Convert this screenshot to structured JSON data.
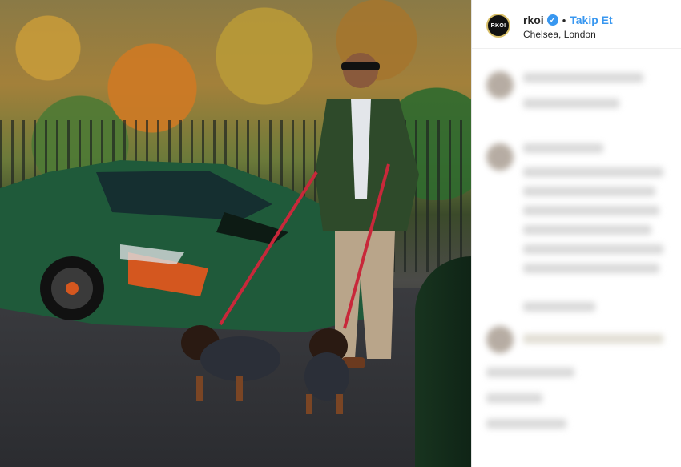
{
  "post": {
    "avatar_text": "RKOI",
    "username": "rkoi",
    "verified_icon": "verified-badge-icon",
    "separator": "•",
    "follow_label": "Takip Et",
    "location": "Chelsea, London"
  },
  "colors": {
    "accent_blue": "#3897f0",
    "car_green": "#1f5a3a",
    "leash_red": "#c8283a"
  }
}
